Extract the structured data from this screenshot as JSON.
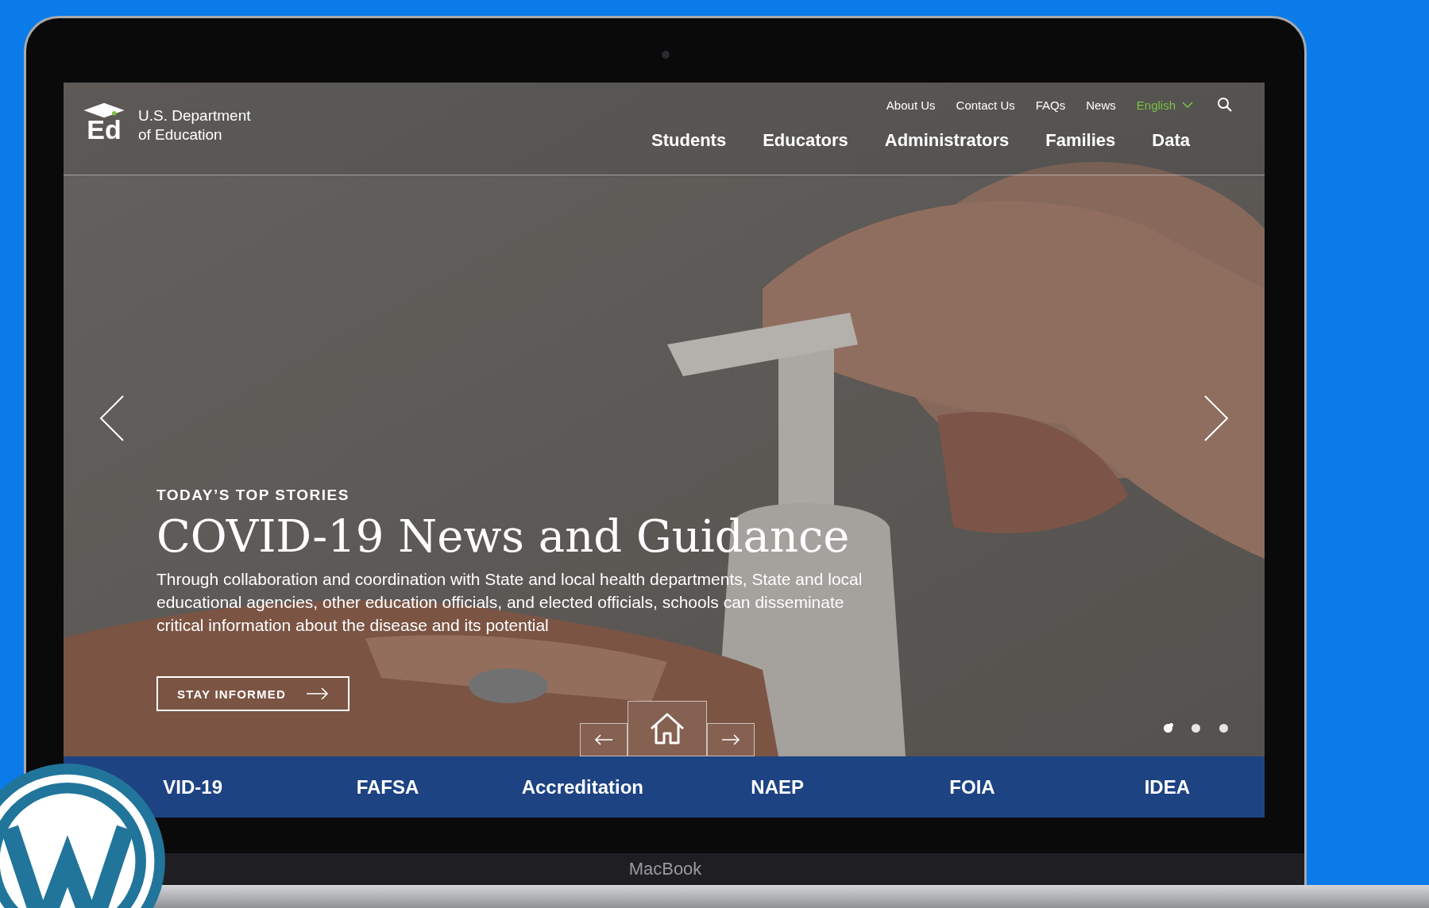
{
  "laptop": {
    "brand": "MacBook"
  },
  "site": {
    "logo_mark": "Ed",
    "logo_text": [
      "U.S. Department",
      "of Education"
    ]
  },
  "utility_nav": [
    "About Us",
    "Contact Us",
    "FAQs",
    "News"
  ],
  "language": {
    "label": "English"
  },
  "main_nav": [
    "Students",
    "Educators",
    "Administrators",
    "Families",
    "Data"
  ],
  "hero": {
    "kicker": "TODAY’S TOP STORIES",
    "title": "COVID-19 News and Guidance",
    "body": "Through collaboration and coordination with State and local health departments, State and local educational agencies, other education officials, and elected officials, schools can disseminate critical information about the disease and its potential",
    "button": "STAY INFORMED",
    "slides": [
      {
        "selected": true
      },
      {
        "selected": false
      },
      {
        "selected": false
      }
    ]
  },
  "quick_links": [
    "VID-19",
    "FAFSA",
    "Accreditation",
    "NAEP",
    "FOIA",
    "IDEA"
  ]
}
